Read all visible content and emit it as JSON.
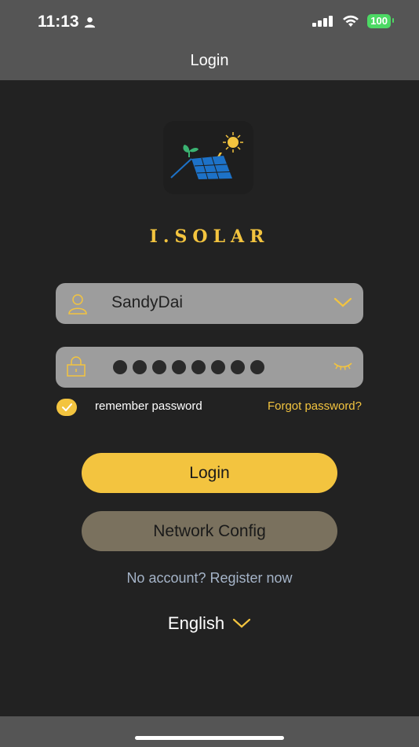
{
  "status": {
    "time": "11:13",
    "battery": "100",
    "icons": [
      "person-icon",
      "cellular-icon",
      "wifi-icon",
      "battery-icon"
    ]
  },
  "nav": {
    "title": "Login"
  },
  "brand": {
    "name": "I.SOLAR"
  },
  "form": {
    "username_value": "SandyDai",
    "password_mask": "••••••••",
    "remember_label": "remember password",
    "forgot_label": "Forgot password?"
  },
  "buttons": {
    "login": "Login",
    "network": "Network Config"
  },
  "register": "No account? Register now",
  "language": "English",
  "colors": {
    "accent": "#f3c43f",
    "background": "#222222",
    "bar": "#555555",
    "field": "#9d9d9d",
    "network_button": "#7a715e",
    "register_link": "#a5b4c8"
  }
}
